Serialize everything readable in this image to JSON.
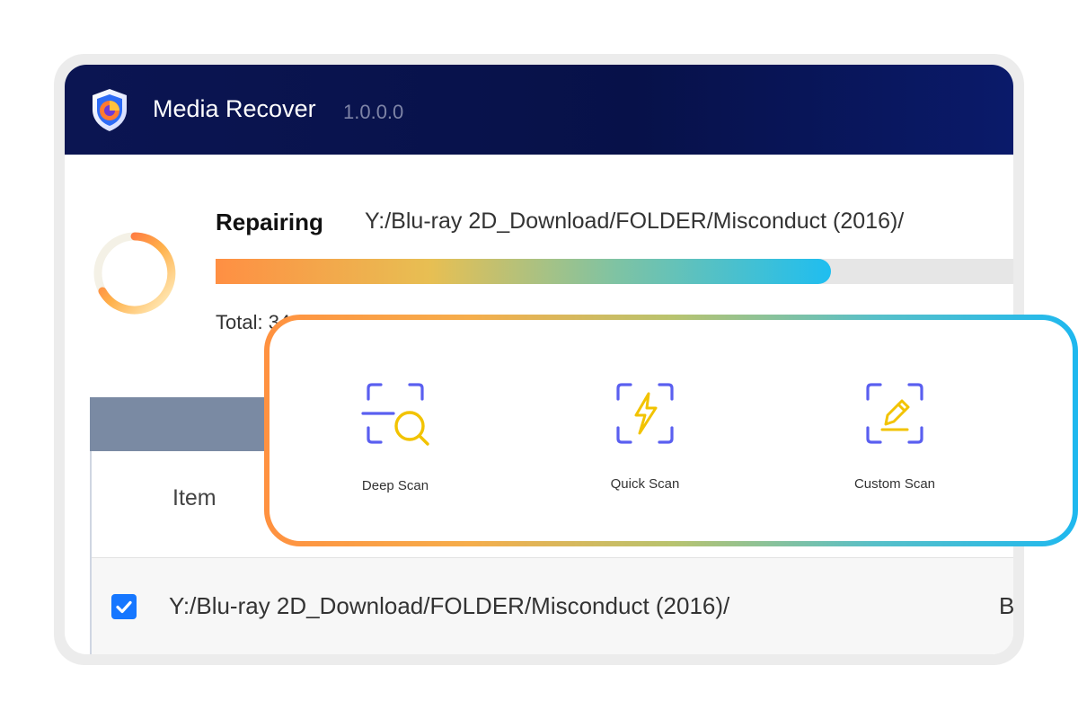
{
  "app": {
    "title": "Media Recover",
    "version": "1.0.0.0"
  },
  "repair": {
    "status_label": "Repairing",
    "path": "Y:/Blu-ray 2D_Download/FOLDER/Misconduct (2016)/",
    "progress": 0.77,
    "stats_text": "Total: 34"
  },
  "table": {
    "columns": [
      "Item"
    ],
    "rows": [
      {
        "checked": true,
        "path": "Y:/Blu-ray 2D_Download/FOLDER/Misconduct (2016)/",
        "extra": "B"
      }
    ]
  },
  "scan_options": [
    {
      "label": "Deep Scan",
      "icon": "deep-scan-icon"
    },
    {
      "label": "Quick Scan",
      "icon": "quick-scan-icon"
    },
    {
      "label": "Custom Scan",
      "icon": "custom-scan-icon"
    }
  ],
  "colors": {
    "titlebar": "#0b1552",
    "icon_frame": "#5a5ff0",
    "icon_accent": "#f2c300",
    "checkbox": "#1677ff",
    "card_gradient_start": "#ff9140",
    "card_gradient_end": "#1eb8ef"
  }
}
